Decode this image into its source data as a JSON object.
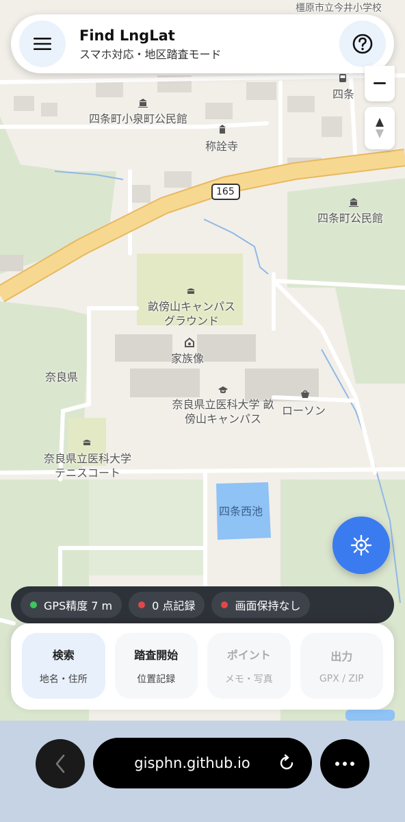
{
  "header": {
    "title": "Find LngLat",
    "subtitle": "スマホ対応・地区踏査モード"
  },
  "map": {
    "labels": {
      "top_right": "橿原市立今井小学校",
      "hall_koizumi": "四条町小泉町公民館",
      "temple": "称詮寺",
      "station": "四条",
      "route": "165",
      "hall_shijo": "四条町公民館",
      "ground": "畝傍山キャンパスグラウンド",
      "statue": "家族像",
      "pref": "奈良県",
      "univ": "奈良県立医科大学 畝傍山キャンパス",
      "lawson": "ローソン",
      "tennis": "奈良県立医科大学テニスコート",
      "pond": "四条西池"
    },
    "colors": {
      "road_major": "#f7d890",
      "water": "#8fc2f5",
      "green": "#dbe6cf"
    }
  },
  "status": {
    "gps": "GPS精度 7 m",
    "records": "0 点記録",
    "screen": "画面保持なし",
    "colors": {
      "gps": "#3cc85a",
      "records": "#e04848",
      "screen": "#e04848"
    }
  },
  "panel": {
    "tiles": [
      {
        "title": "検索",
        "sub": "地名・住所"
      },
      {
        "title": "踏査開始",
        "sub": "位置記録"
      },
      {
        "title": "ポイント",
        "sub": "メモ・写真"
      },
      {
        "title": "出力",
        "sub": "GPX / ZIP"
      }
    ]
  },
  "browser": {
    "url": "gisphn.github.io"
  },
  "icons": {
    "menu": "menu-icon",
    "help": "help-icon",
    "zoom_out": "minus-icon",
    "compass": "compass-icon",
    "locate": "crosshair-icon",
    "back": "chevron-left-icon",
    "reload": "reload-icon",
    "more": "more-icon"
  }
}
